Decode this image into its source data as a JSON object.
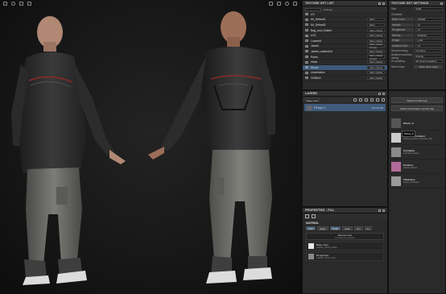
{
  "texture_set_list": {
    "title": "TEXTURE SET LIST",
    "settings_label": "Settings",
    "rows": [
      {
        "name": "UV",
        "shader": ""
      },
      {
        "name": "Mr_Default1",
        "shader": "Main"
      },
      {
        "name": "Mr_Default2",
        "shader": "Main"
      },
      {
        "name": "Bag_and_Holster",
        "shader": "Main shader"
      },
      {
        "name": "UV1",
        "shader": "Main shader"
      },
      {
        "name": "Lowerbit",
        "shader": "Main shader"
      },
      {
        "name": "Jacket",
        "shader": "Main shader (Copy)"
      },
      {
        "name": "Jacket_undershirt",
        "shader": "Main shader"
      },
      {
        "name": "Pants",
        "shader": "Main shader (Copy)"
      },
      {
        "name": "Head",
        "shader": "Main shader"
      },
      {
        "name": "Shoes",
        "shader": "Main shader"
      },
      {
        "name": "Underfabric",
        "shader": "Main shader"
      },
      {
        "name": "VISIBLE",
        "shader": "Main shader"
      }
    ],
    "selected_index": 10
  },
  "texture_set_settings": {
    "title": "TEXTURE SET SETTINGS",
    "size_label": "Size",
    "size_value": "2048",
    "channels_label": "Channels",
    "rows": [
      {
        "label": "Base Color",
        "value": "sRGB8"
      },
      {
        "label": "Metallic",
        "value": "L8"
      },
      {
        "label": "Roughness",
        "value": "L8"
      },
      {
        "label": "Normal",
        "value": "RGB16F"
      },
      {
        "label": "Height",
        "value": "L16F"
      },
      {
        "label": "Ambient Occl.",
        "value": "L8"
      }
    ],
    "normal_mixing_label": "Normal mixing",
    "normal_mixing_value": "Combine",
    "ao_mixing_label": "Ambient occlusion mixing",
    "ao_mixing_value": "Multiply",
    "uv_padding_label": "UV padding",
    "uv_padding_value": "3D Space Neighbor",
    "mesh_maps_label": "Mesh maps",
    "bake_button": "Bake Mesh Maps"
  },
  "layers": {
    "title": "LAYERS",
    "channel_select": "Base color",
    "layer": {
      "name": "Fill layer 1",
      "blend": "Normal",
      "opacity": "100"
    }
  },
  "shelf": {
    "select_mesh_button": "Select normal map",
    "select_cavity_button": "Select world space normal map",
    "tooltip": "Shoes_S",
    "items": [
      {
        "name": "Shoes_S",
        "sub": "",
        "color": "#555555"
      },
      {
        "name": "Ambient occlusion",
        "sub": "Shoes_ambient_occlusion_MS",
        "color": "#cccccc"
      },
      {
        "name": "Curvature",
        "sub": "Curvature Shoes",
        "color": "#8a8a8a"
      },
      {
        "name": "Position",
        "sub": "Position Shoes",
        "color": "#b06b9a"
      },
      {
        "name": "Thickness",
        "sub": "Shoes_thickness",
        "color": "#9a9a9a"
      }
    ]
  },
  "properties": {
    "title": "PROPERTIES - FILL",
    "material_label": "MATERIAL",
    "channels": [
      {
        "label": "color",
        "on": true
      },
      {
        "label": "height",
        "on": false
      },
      {
        "label": "rough",
        "on": true
      },
      {
        "label": "metal",
        "on": false
      },
      {
        "label": "nrm",
        "on": false
      },
      {
        "label": "ao",
        "on": false
      }
    ],
    "material_mode": "Material mode",
    "material_mode_sub": "No Resource Selected",
    "items": [
      {
        "name": "Base Color",
        "sub": "Leather_Shoes_White",
        "color": "#e8e8e8"
      },
      {
        "name": "Roughness",
        "sub": "Leather_Shoes_Nrm",
        "color": "#8a8a8a"
      }
    ]
  }
}
